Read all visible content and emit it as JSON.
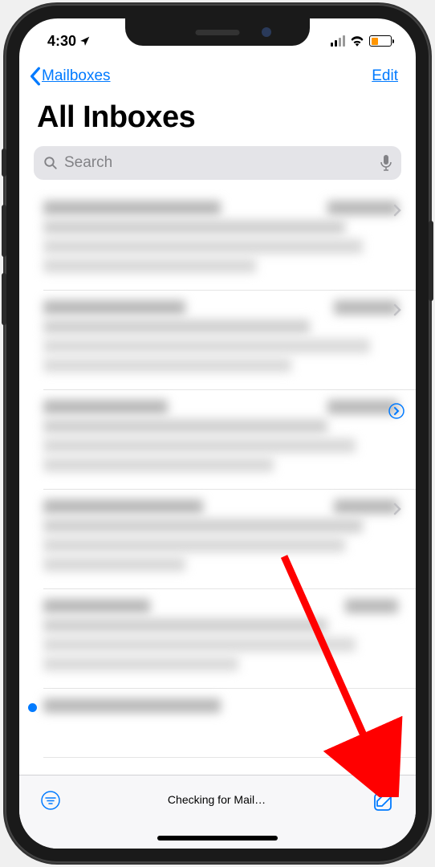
{
  "status": {
    "time": "4:30",
    "location_on": true
  },
  "nav": {
    "back_label": "Mailboxes",
    "edit_label": "Edit"
  },
  "page_title": "All Inboxes",
  "search": {
    "placeholder": "Search"
  },
  "toolbar": {
    "status_text": "Checking for Mail…"
  },
  "colors": {
    "ios_blue": "#007aff",
    "battery_low_orange": "#ff9500",
    "annotation_red": "#ff0000"
  },
  "mail_items": [
    {
      "has_chevron": true,
      "unread": false
    },
    {
      "has_chevron": true,
      "unread": false
    },
    {
      "has_thread": true,
      "unread": false
    },
    {
      "has_chevron": true,
      "unread": false
    },
    {
      "has_chevron": false,
      "unread": false
    },
    {
      "has_chevron": false,
      "unread": true
    }
  ]
}
